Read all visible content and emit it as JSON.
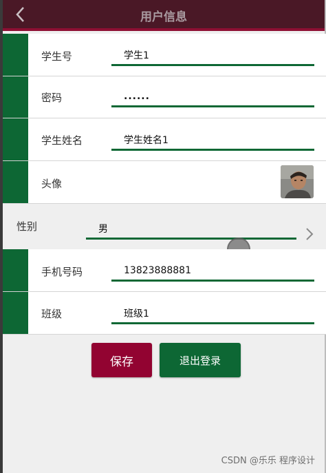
{
  "header": {
    "title": "用户信息"
  },
  "form": {
    "student_no": {
      "label": "学生号",
      "value": "学生1"
    },
    "password": {
      "label": "密码",
      "value": "......"
    },
    "student_name": {
      "label": "学生姓名",
      "value": "学生姓名1"
    },
    "avatar": {
      "label": "头像"
    },
    "gender": {
      "label": "性别",
      "value": "男"
    },
    "phone": {
      "label": "手机号码",
      "value": "13823888881"
    },
    "class": {
      "label": "班级",
      "value": "班级1"
    }
  },
  "actions": {
    "save_label": "保存",
    "logout_label": "退出登录"
  },
  "watermark": "CSDN @乐乐 程序设计",
  "colors": {
    "header": "#4a1826",
    "accent_red": "#920331",
    "accent_green": "#0d6734"
  },
  "icons": {
    "back": "chevron-left-icon",
    "dropdown": "chevron-right-icon"
  }
}
